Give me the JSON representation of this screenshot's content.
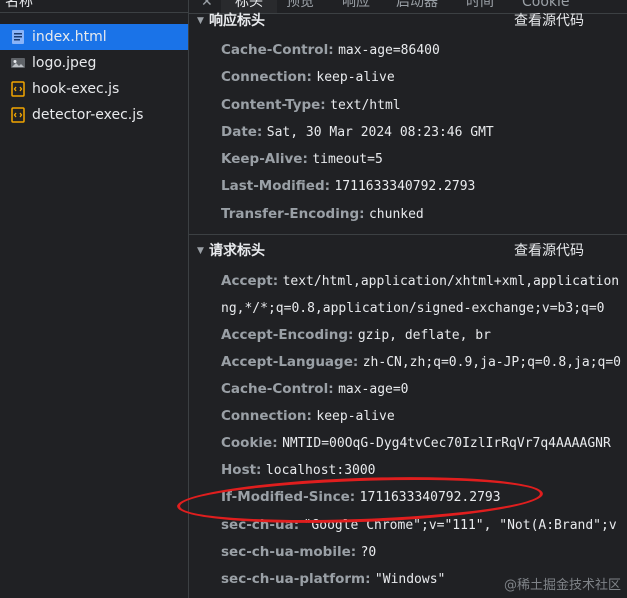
{
  "left": {
    "header": "名称",
    "files": [
      {
        "name": "index.html",
        "icon": "document-icon",
        "selected": true
      },
      {
        "name": "logo.jpeg",
        "icon": "image-icon",
        "selected": false
      },
      {
        "name": "hook-exec.js",
        "icon": "script-icon",
        "selected": false
      },
      {
        "name": "detector-exec.js",
        "icon": "script-icon",
        "selected": false
      }
    ]
  },
  "tabs": {
    "close": "✕",
    "items": [
      "标头",
      "预览",
      "响应",
      "启动器",
      "时间",
      "Cookie"
    ],
    "active": "标头"
  },
  "response_headers": {
    "title": "响应标头",
    "view_source": "查看源代码",
    "rows": [
      {
        "key": "Cache-Control:",
        "value": "max-age=86400"
      },
      {
        "key": "Connection:",
        "value": "keep-alive"
      },
      {
        "key": "Content-Type:",
        "value": "text/html"
      },
      {
        "key": "Date:",
        "value": "Sat, 30 Mar 2024 08:23:46 GMT"
      },
      {
        "key": "Keep-Alive:",
        "value": "timeout=5"
      },
      {
        "key": "Last-Modified:",
        "value": "1711633340792.2793"
      },
      {
        "key": "Transfer-Encoding:",
        "value": "chunked"
      }
    ]
  },
  "request_headers": {
    "title": "请求标头",
    "view_source": "查看源代码",
    "rows": [
      {
        "key": "Accept:",
        "value": "text/html,application/xhtml+xml,application"
      },
      {
        "key": "",
        "value": "ng,*/*;q=0.8,application/signed-exchange;v=b3;q=0"
      },
      {
        "key": "Accept-Encoding:",
        "value": "gzip, deflate, br"
      },
      {
        "key": "Accept-Language:",
        "value": "zh-CN,zh;q=0.9,ja-JP;q=0.8,ja;q=0"
      },
      {
        "key": "Cache-Control:",
        "value": "max-age=0"
      },
      {
        "key": "Connection:",
        "value": "keep-alive"
      },
      {
        "key": "Cookie:",
        "value": "NMTID=00OqG-Dyg4tvCec70IzlIrRqVr7q4AAAAGNR"
      },
      {
        "key": "Host:",
        "value": "localhost:3000"
      },
      {
        "key": "If-Modified-Since:",
        "value": "1711633340792.2793"
      },
      {
        "key": "sec-ch-ua:",
        "value": "\"Google Chrome\";v=\"111\", \"Not(A:Brand\";v"
      },
      {
        "key": "sec-ch-ua-mobile:",
        "value": "?0"
      },
      {
        "key": "sec-ch-ua-platform:",
        "value": "\"Windows\""
      }
    ]
  },
  "watermark": "@稀土掘金技术社区",
  "colors": {
    "selected_row": "#1a73e8",
    "annotation": "#e01e1e",
    "background": "#202124"
  }
}
